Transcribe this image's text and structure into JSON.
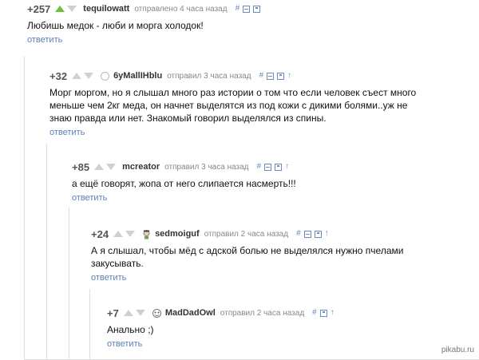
{
  "comments": [
    {
      "rating": "+257",
      "username": "tequilowatt",
      "posted": "отправлено 4 часа назад",
      "text": "Любишь медок - люби и морга холодок!",
      "reply": "ответить"
    },
    {
      "rating": "+32",
      "username": "6yMallIHblu",
      "posted": "отправил 3 часа назад",
      "text": "Морг моргом, но я слышал много раз истории о том что если человек съест много меньше чем 2кг меда, он начнет выделятся из под кожи с дикими болями..уж не знаю правда или нет. Знакомый говорил выделялся из спины.",
      "reply": "ответить"
    },
    {
      "rating": "+85",
      "username": "mcreator",
      "posted": "отправил 3 часа назад",
      "text": "а ещё говорят, жопа от него слипается насмерть!!!",
      "reply": "ответить"
    },
    {
      "rating": "+24",
      "username": "sedmoiguf",
      "posted": "отправил 2 часа назад",
      "text": "А я слышал, чтобы мёд с адской болью не выделялся нужно пчелами закусывать.",
      "reply": "ответить"
    },
    {
      "rating": "+7",
      "username": "MadDadOwl",
      "posted": "отправил 2 часа назад",
      "text": "Анально ;)",
      "reply": "ответить"
    }
  ],
  "watermark": "pikabu.ru",
  "colors": {
    "up_active": "#6fbf3a",
    "arrow_inactive": "#d0d0d0",
    "link": "#5a7fb8",
    "icon": "#6a8bc0"
  },
  "icons": [
    "hash-icon",
    "collapse-icon",
    "save-icon",
    "parent-arrow-icon"
  ]
}
